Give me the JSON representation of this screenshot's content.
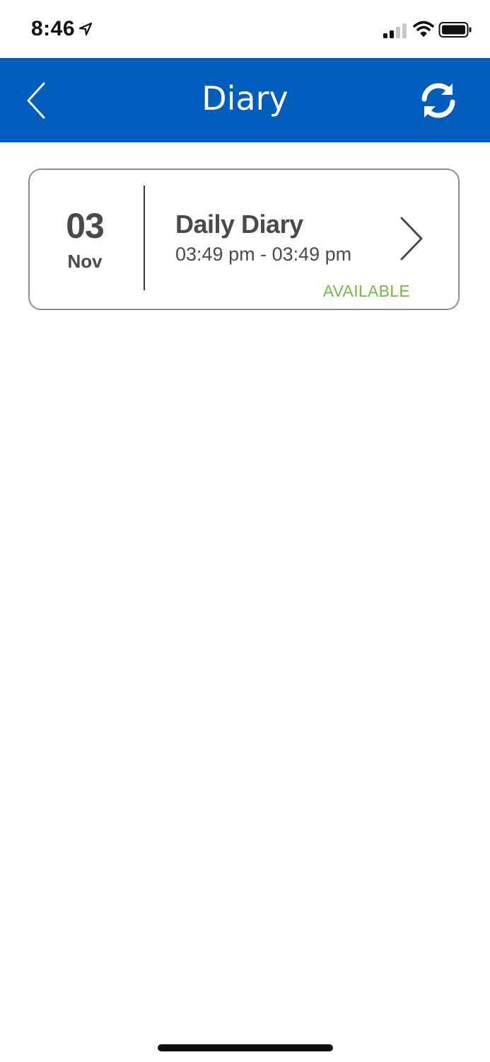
{
  "status_bar": {
    "time": "8:46",
    "icons": [
      "location-arrow-icon",
      "cellular-signal-icon",
      "wifi-icon",
      "battery-icon"
    ]
  },
  "header": {
    "title": "Diary",
    "back_icon": "chevron-left-icon",
    "refresh_icon": "refresh-icon",
    "background_color": "#005dbb"
  },
  "diary_entries": [
    {
      "day": "03",
      "month": "Nov",
      "title": "Daily Diary",
      "time_range": "03:49 pm - 03:49 pm",
      "status": "AVAILABLE",
      "status_color": "#7ab648",
      "action_icon": "chevron-right-icon"
    }
  ]
}
